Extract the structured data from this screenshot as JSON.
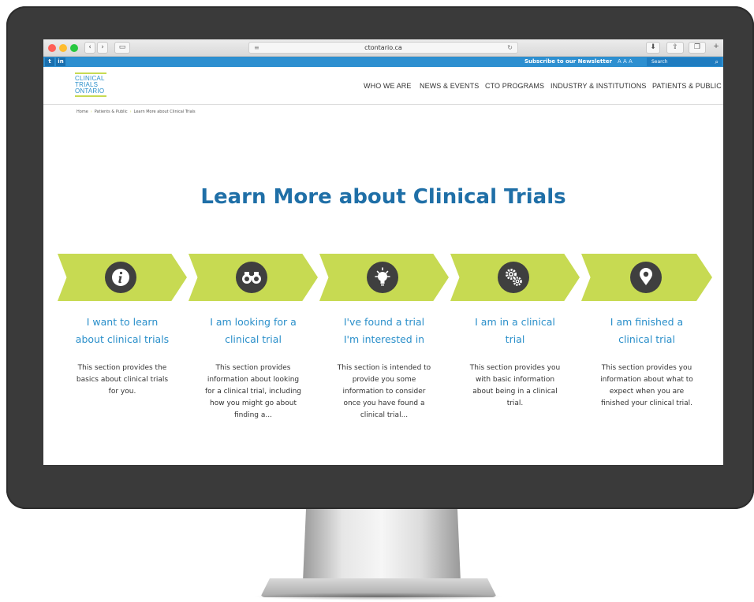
{
  "browser": {
    "address": "ctontario.ca"
  },
  "topbar": {
    "twitter": "t",
    "linkedin": "in",
    "newsletter": "Subscribe to our Newsletter",
    "font_sizes": "A A A",
    "search_placeholder": "Search"
  },
  "logo": {
    "line1": "CLINICAL",
    "line2": "TRIALS",
    "line3": "ONTARIO"
  },
  "nav": [
    "WHO WE ARE",
    "NEWS & EVENTS",
    "CTO PROGRAMS",
    "INDUSTRY & INSTITUTIONS",
    "PATIENTS & PUBLIC"
  ],
  "breadcrumb": [
    "Home",
    "Patients & Public",
    "Learn More about Clinical Trials"
  ],
  "page_title": "Learn More about Clinical Trials",
  "steps": [
    {
      "icon": "info-icon",
      "title1": "I want to learn",
      "title2": "about clinical trials",
      "desc": [
        "This section provides the",
        "basics about clinical trials",
        "for you."
      ]
    },
    {
      "icon": "binoculars-icon",
      "title1": "I am looking for a",
      "title2": "clinical trial",
      "desc": [
        "This section provides",
        "information about looking",
        "for a clinical trial, including",
        "how you might go about",
        "finding a..."
      ]
    },
    {
      "icon": "lightbulb-icon",
      "title1": "I've found a trial",
      "title2": "I'm interested in",
      "desc": [
        "This section is intended to",
        "provide you some",
        "information to consider",
        "once you have found a",
        "clinical trial..."
      ]
    },
    {
      "icon": "gears-icon",
      "title1": "I am in a clinical",
      "title2": "trial",
      "desc": [
        "This section provides you",
        "with basic information",
        "about being in a clinical",
        "trial."
      ]
    },
    {
      "icon": "location-pin-icon",
      "title1": "I am finished a",
      "title2": "clinical trial",
      "desc": [
        "This section provides you",
        "information about what to",
        "expect when you are",
        "finished your clinical trial."
      ]
    }
  ],
  "colors": {
    "accent_green": "#c7da52",
    "brand_blue": "#2a8fca",
    "title_blue": "#1f6fa7",
    "topbar_blue": "#2d8fd0"
  }
}
